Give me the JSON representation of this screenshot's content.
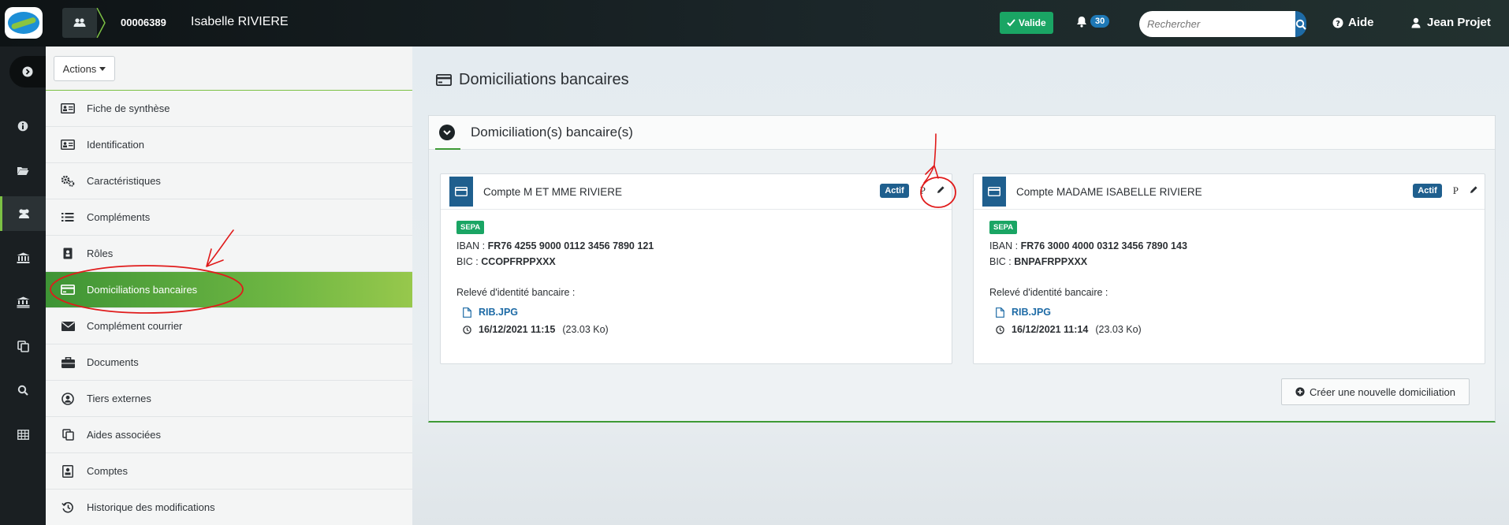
{
  "topbar": {
    "dossier_number": "00006389",
    "person_name": "Isabelle RIVIERE",
    "status": "Valide",
    "notifications_count": "30",
    "search_placeholder": "Rechercher",
    "help_label": "Aide",
    "user_name": "Jean Projet"
  },
  "rail": {
    "items": [
      "collapse-toggle",
      "info-icon",
      "folder-icon",
      "users-icon",
      "bank-icon",
      "bank-alt-icon",
      "copy-icon",
      "search-icon",
      "grid-icon"
    ],
    "active_index": 3
  },
  "sidebar": {
    "actions_label": "Actions",
    "items": [
      {
        "label": "Fiche de synthèse",
        "icon": "id-card-icon"
      },
      {
        "label": "Identification",
        "icon": "vcard-icon"
      },
      {
        "label": "Caractéristiques",
        "icon": "cogs-icon"
      },
      {
        "label": "Compléments",
        "icon": "list-icon"
      },
      {
        "label": "Rôles",
        "icon": "role-icon"
      },
      {
        "label": "Domiciliations bancaires",
        "icon": "credit-card-icon",
        "active": true
      },
      {
        "label": "Complément courrier",
        "icon": "envelope-icon"
      },
      {
        "label": "Documents",
        "icon": "briefcase-icon"
      },
      {
        "label": "Tiers externes",
        "icon": "user-circle-icon"
      },
      {
        "label": "Aides associées",
        "icon": "copy-icon"
      },
      {
        "label": "Comptes",
        "icon": "contact-icon"
      },
      {
        "label": "Historique des modifications",
        "icon": "history-icon"
      }
    ]
  },
  "main": {
    "page_title": "Domiciliations bancaires",
    "panel_title": "Domiciliation(s) bancaire(s)",
    "create_label": "Créer une nouvelle domiciliation",
    "cards": [
      {
        "title": "Compte M ET MME RIVIERE",
        "status": "Actif",
        "p_label": "P",
        "badge": "SEPA",
        "iban_label": "IBAN :",
        "iban": "FR76 4255 9000 0112 3456 7890 121",
        "bic_label": "BIC :",
        "bic": "CCOPFRPPXXX",
        "rib_label": "Relevé d'identité bancaire :",
        "file_name": "RIB.JPG",
        "file_date": "16/12/2021 11:15",
        "file_size": "(23.03 Ko)"
      },
      {
        "title": "Compte MADAME ISABELLE RIVIERE",
        "status": "Actif",
        "p_label": "P",
        "badge": "SEPA",
        "iban_label": "IBAN :",
        "iban": "FR76 3000 4000 0312 3456 7890 143",
        "bic_label": "BIC :",
        "bic": "BNPAFRPPXXX",
        "rib_label": "Relevé d'identité bancaire :",
        "file_name": "RIB.JPG",
        "file_date": "16/12/2021 11:14",
        "file_size": "(23.03 Ko)"
      }
    ]
  },
  "colors": {
    "topbar_bg": "#1b2629",
    "accent_green": "#6fb743",
    "status_green": "#1aa564",
    "brand_blue": "#1f5f8e",
    "link_blue": "#1e6ba6",
    "annotation_red": "#e01b1b"
  }
}
